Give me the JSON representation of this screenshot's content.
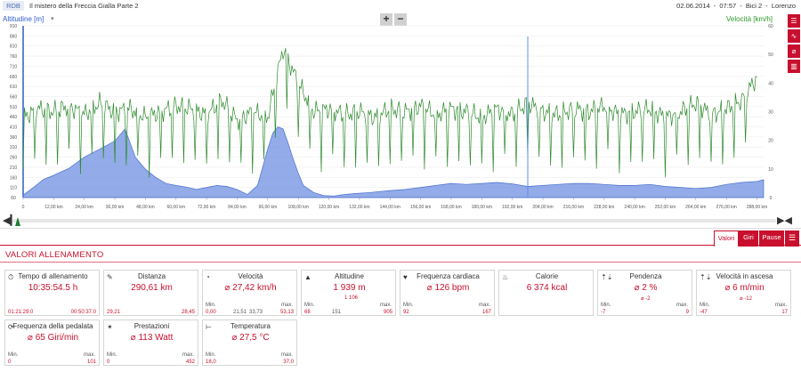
{
  "header": {
    "badge": "RDB",
    "title": "Il mistero della Freccia Gialla Parte 2",
    "date": "02.06.2014",
    "sep1": "-",
    "time": "07:57",
    "sep2": "-",
    "bike": "Bici 2",
    "sep3": "-",
    "user": "Lorenzo"
  },
  "chart": {
    "left_axis_title": "Altitudine [m]",
    "right_axis_title": "Velocità [km/h]",
    "left_ticks": [
      "910",
      "860",
      "810",
      "760",
      "710",
      "660",
      "610",
      "560",
      "510",
      "460",
      "410",
      "360",
      "310",
      "260",
      "210",
      "160",
      "110",
      "60"
    ],
    "right_ticks": [
      "60",
      "50",
      "40",
      "30",
      "20",
      "10",
      "0"
    ],
    "x_ticks": [
      "0",
      "12,00 km",
      "24,00 km",
      "36,00 km",
      "48,00 km",
      "60,00 km",
      "72,00 km",
      "84,00 km",
      "96,00 km",
      "108,00 km",
      "120,00 km",
      "132,00 km",
      "144,00 km",
      "156,00 km",
      "168,00 km",
      "180,00 km",
      "192,00 km",
      "204,00 km",
      "216,00 km",
      "228,00 km",
      "240,00 km",
      "252,00 km",
      "264,00 km",
      "276,00 km",
      "288,00 km"
    ],
    "zoom_in": "+",
    "zoom_out": "−",
    "altitude_color": "#6f8fe0",
    "speed_color": "#2d8a2d"
  },
  "chart_data": {
    "type": "area",
    "xlabel": "",
    "ylabel": "Altitudine [m]",
    "ylabel_right": "Velocità [km/h]",
    "xlim_km": [
      0,
      290.61
    ],
    "ylim": [
      60,
      910
    ],
    "ylim_right": [
      0,
      60
    ],
    "series": [
      {
        "name": "Altitudine [m]",
        "x": [
          0,
          4,
          8,
          12,
          18,
          24,
          30,
          36,
          40,
          44,
          48,
          52,
          56,
          60,
          64,
          68,
          72,
          76,
          80,
          84,
          88,
          92,
          96,
          98,
          100,
          102,
          104,
          106,
          108,
          110,
          114,
          118,
          122,
          126,
          130,
          136,
          144,
          150,
          156,
          162,
          168,
          174,
          180,
          186,
          192,
          198,
          204,
          210,
          216,
          222,
          228,
          234,
          240,
          246,
          252,
          258,
          264,
          270,
          276,
          282,
          288,
          290.6
        ],
        "y": [
          72,
          110,
          150,
          170,
          205,
          260,
          300,
          340,
          400,
          260,
          200,
          160,
          130,
          120,
          112,
          100,
          110,
          120,
          115,
          100,
          75,
          120,
          300,
          380,
          410,
          400,
          330,
          250,
          180,
          120,
          85,
          70,
          68,
          75,
          80,
          85,
          95,
          100,
          110,
          120,
          130,
          125,
          130,
          135,
          128,
          115,
          120,
          125,
          130,
          130,
          125,
          120,
          120,
          125,
          115,
          110,
          105,
          110,
          125,
          135,
          140,
          148
        ]
      },
      {
        "name": "Velocità [km/h]",
        "note_fields": "x in km, y in km/h",
        "x": [
          0,
          6,
          12,
          18,
          24,
          30,
          36,
          42,
          48,
          54,
          60,
          66,
          72,
          78,
          84,
          90,
          96,
          102,
          108,
          114,
          120,
          126,
          132,
          138,
          144,
          150,
          156,
          162,
          168,
          174,
          180,
          186,
          192,
          198,
          204,
          210,
          216,
          222,
          228,
          234,
          240,
          246,
          252,
          258,
          264,
          270,
          276,
          282,
          288
        ],
        "y": [
          28,
          31,
          30,
          32,
          29,
          33,
          30,
          31,
          28,
          30,
          32,
          31,
          29,
          34,
          27,
          30,
          28,
          52,
          40,
          30,
          31,
          29,
          30,
          28,
          31,
          30,
          32,
          29,
          31,
          30,
          28,
          31,
          29,
          33,
          30,
          29,
          31,
          30,
          32,
          29,
          30,
          31,
          28,
          30,
          33,
          29,
          31,
          34,
          42
        ]
      }
    ]
  },
  "tabs": [
    "Valori",
    "Giri",
    "Pause"
  ],
  "section_title": "VALORI ALLENAMENTO",
  "cards": [
    {
      "label": "Tempo di allenamento",
      "value": "10:35:54.5 h",
      "min_label": "",
      "min": "01:21:29.0",
      "mid1": "",
      "mid2": "",
      "max_label": "",
      "max": "00:50:37.0"
    },
    {
      "label": "Distanza",
      "value": "290,61 km",
      "min_label": "",
      "min": "29,21",
      "mid1": "",
      "mid2": "",
      "max_label": "",
      "max": "28,45"
    },
    {
      "label": "Velocità",
      "value": "⌀ 27,42 km/h",
      "min_label": "Min.",
      "min": "0,00",
      "mid1": "21,51",
      "mid2": "33,73",
      "max_label": "max.",
      "max": "53,13"
    },
    {
      "label": "Altitudine",
      "value": "1 939 m",
      "sub": "1 106",
      "min_label": "Min.",
      "min": "68",
      "mid1": "151",
      "mid2": "",
      "max_label": "max.",
      "max": "905"
    },
    {
      "label": "Frequenza cardiaca",
      "value": "⌀ 126 bpm",
      "min_label": "Min.",
      "min": "92",
      "mid1": "",
      "mid2": "",
      "max_label": "max.",
      "max": "167"
    },
    {
      "label": "Calorie",
      "value": "6 374 kcal",
      "min_label": "",
      "min": "",
      "mid1": "",
      "mid2": "",
      "max_label": "",
      "max": ""
    },
    {
      "label": "Pendenza",
      "value": "⌀ 2 %",
      "sub": "⌀ -2",
      "min_label": "Min.",
      "min": "-7",
      "mid1": "",
      "mid2": "",
      "max_label": "max.",
      "max": "9"
    },
    {
      "label": "Velocità in ascesa",
      "value": "⌀ 6 m/min",
      "sub": "⌀ -12",
      "min_label": "Min.",
      "min": "-47",
      "mid1": "",
      "mid2": "",
      "max_label": "max.",
      "max": "17"
    },
    {
      "label": "Frequenza della pedalata",
      "value": "⌀ 65 Giri/min",
      "min_label": "Min.",
      "min": "0",
      "mid1": "",
      "mid2": "",
      "max_label": "max.",
      "max": "101"
    },
    {
      "label": "Prestazioni",
      "value": "⌀ 113 Watt",
      "min_label": "Min.",
      "min": "0",
      "mid1": "",
      "mid2": "",
      "max_label": "max.",
      "max": "452"
    },
    {
      "label": "Temperatura",
      "value": "⌀ 27,5 °C",
      "min_label": "Min.",
      "min": "18,0",
      "mid1": "",
      "mid2": "",
      "max_label": "max.",
      "max": "37,0"
    }
  ]
}
